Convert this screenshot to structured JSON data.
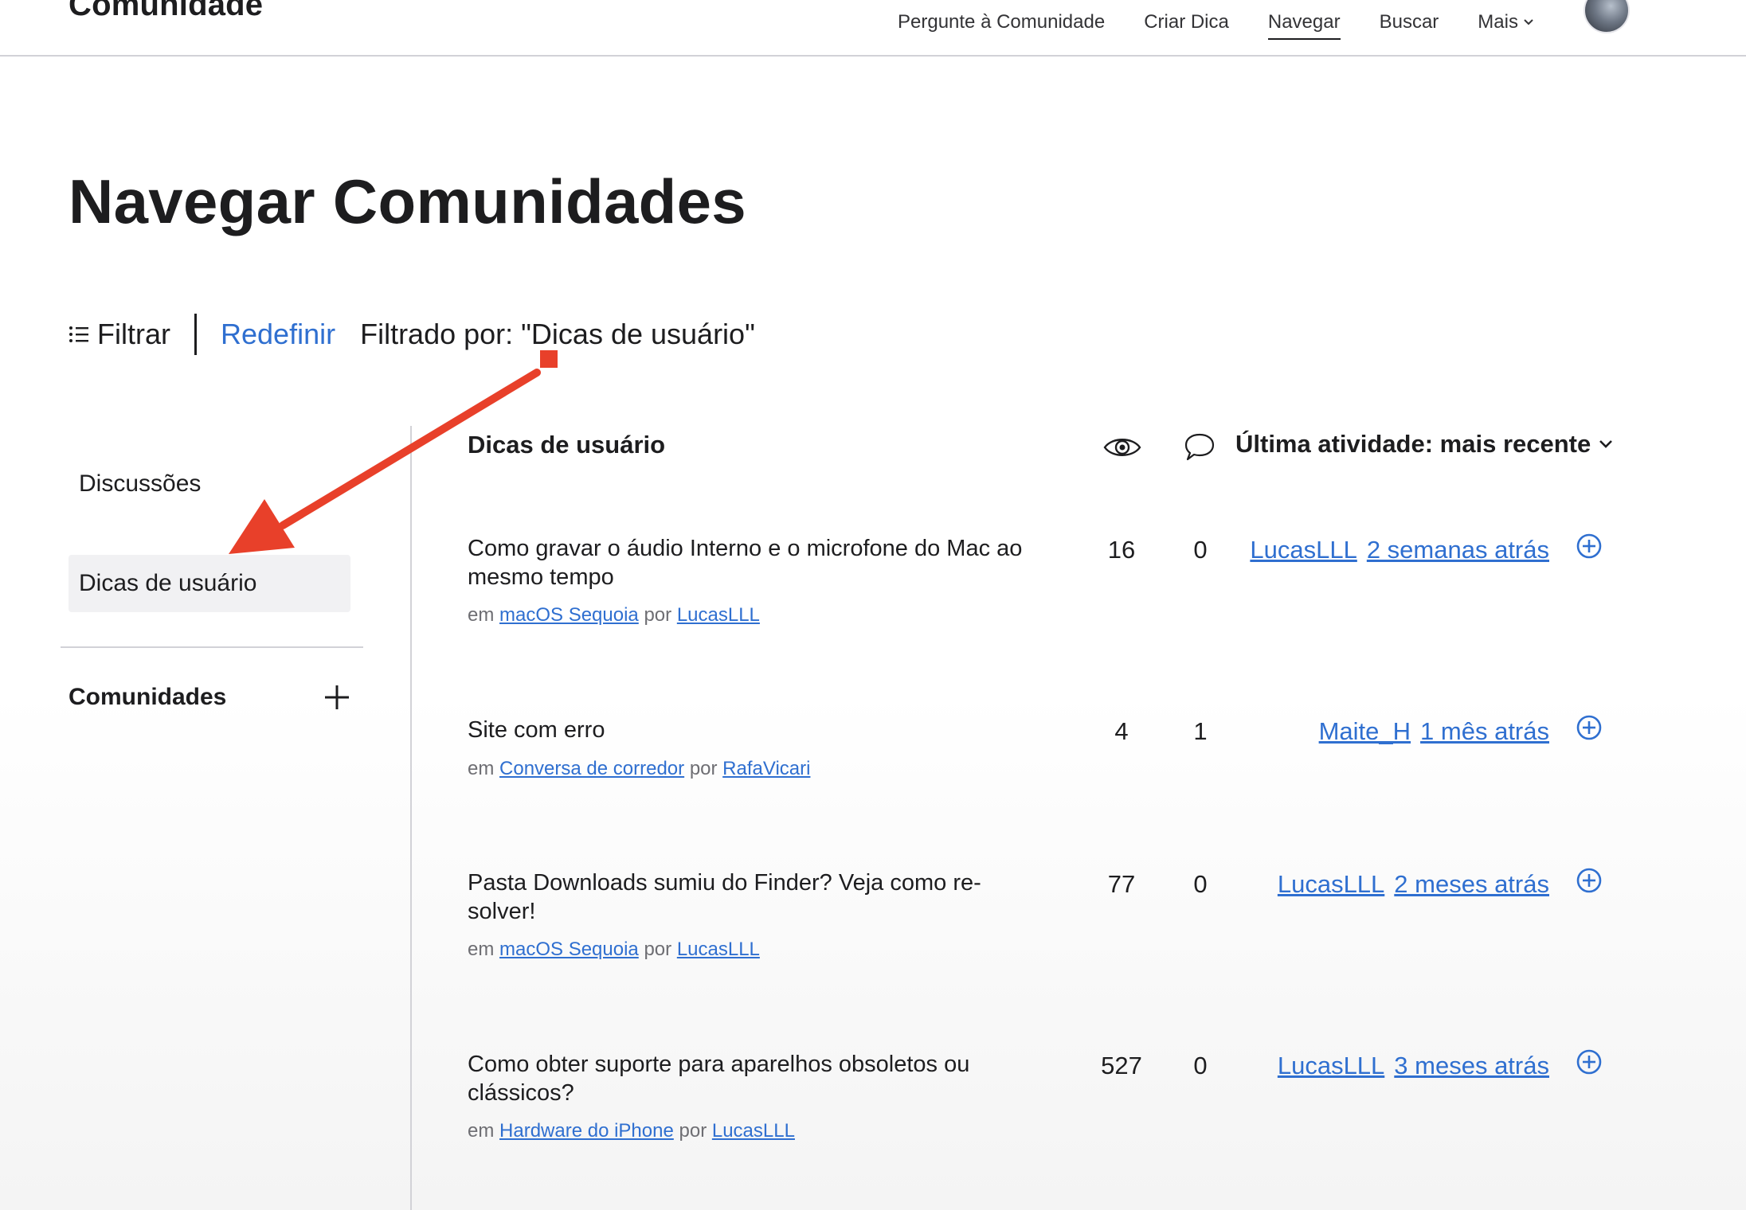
{
  "header": {
    "brand": "Comunidade",
    "nav": [
      {
        "label": "Pergunte à Comunidade",
        "active": false
      },
      {
        "label": "Criar Dica",
        "active": false
      },
      {
        "label": "Navegar",
        "active": true
      },
      {
        "label": "Buscar",
        "active": false
      }
    ],
    "more_label": "Mais"
  },
  "page": {
    "title": "Navegar Comunidades"
  },
  "filterbar": {
    "filter_label": "Filtrar",
    "reset_label": "Redefinir",
    "filtered_text": "Filtrado por: \"Dicas de usuário\""
  },
  "sidebar": {
    "items": [
      {
        "label": "Discussões",
        "selected": false
      },
      {
        "label": "Dicas de usuário",
        "selected": true
      }
    ],
    "communities_label": "Comunidades"
  },
  "list": {
    "heading": "Dicas de usuário",
    "sort_label": "Última atividade: mais recente",
    "meta_in": "em",
    "meta_by": "por",
    "rows": [
      {
        "title": "Como gravar o áudio Interno e o microfone do Mac ao mesmo tempo",
        "community": "macOS Sequoia",
        "author": "LucasLLL",
        "views": "16",
        "replies": "0",
        "last_user": "LucasLLL",
        "last_time": "2 semanas atrás"
      },
      {
        "title": "Site com erro",
        "community": "Conversa de corredor",
        "author": "RafaVicari",
        "views": "4",
        "replies": "1",
        "last_user": "Maite_H",
        "last_time": "1 mês atrás"
      },
      {
        "title": "Pasta Downloads sumiu do Finder? Veja como re­solver!",
        "community": "macOS Sequoia",
        "author": "LucasLLL",
        "views": "77",
        "replies": "0",
        "last_user": "LucasLLL",
        "last_time": "2 meses atrás"
      },
      {
        "title": "Como obter suporte para aparelhos obsoletos ou clássicos?",
        "community": "Hardware do iPhone",
        "author": "LucasLLL",
        "views": "527",
        "replies": "0",
        "last_user": "LucasLLL",
        "last_time": "3 meses atrás"
      }
    ]
  },
  "colors": {
    "link": "#2f6fd0",
    "text": "#1d1d1f",
    "annotation": "#e8402a"
  }
}
